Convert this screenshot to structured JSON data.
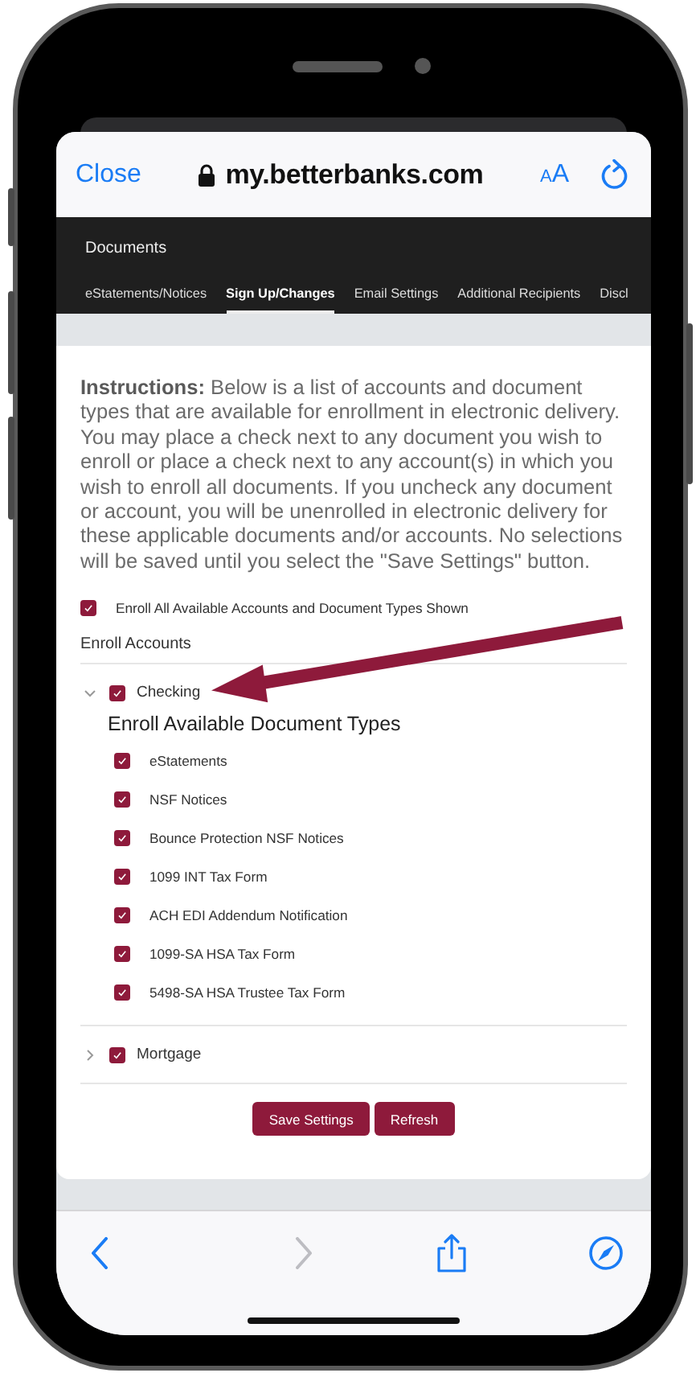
{
  "browser": {
    "close": "Close",
    "domain": "my.betterbanks.com",
    "text_size": "AA"
  },
  "site_nav": {
    "title": "Documents",
    "tabs": [
      {
        "label": "eStatements/Notices",
        "selected": false
      },
      {
        "label": "Sign Up/Changes",
        "selected": true
      },
      {
        "label": "Email Settings",
        "selected": false
      },
      {
        "label": "Additional Recipients",
        "selected": false
      },
      {
        "label": "Discl",
        "selected": false
      }
    ]
  },
  "instructions": "**Instructions:** Below is a list of accounts and document types that are available for enrollment in electronic delivery. You may place a check next to any document you wish to enroll or place a check next to any account(s) in which you wish to enroll all documents. If you uncheck any document or account, you will be unenrolled in electronic delivery for these applicable documents and/or accounts. No selections will be saved until you select the \"Save Settings\" button.",
  "enroll_all": {
    "label": "Enroll All Available Accounts and Document Types Shown",
    "checked": true
  },
  "accounts_heading": "Enroll Accounts",
  "accounts": [
    {
      "name": "Checking",
      "checked": true,
      "expanded": true,
      "documents_heading": "Enroll Available Document Types",
      "children": [
        {
          "label": "eStatements",
          "checked": true
        },
        {
          "label": "NSF Notices",
          "checked": true
        },
        {
          "label": "Bounce Protection NSF Notices",
          "checked": true
        },
        {
          "label": "1099 INT Tax Form",
          "checked": true
        },
        {
          "label": "ACH EDI Addendum Notification",
          "checked": true
        },
        {
          "label": "1099-SA HSA Tax Form",
          "checked": true
        },
        {
          "label": "5498-SA HSA Trustee Tax Form",
          "checked": true
        }
      ]
    },
    {
      "name": "Mortgage",
      "checked": true,
      "expanded": false
    }
  ],
  "buttons": [
    "Save Settings",
    "Refresh"
  ]
}
